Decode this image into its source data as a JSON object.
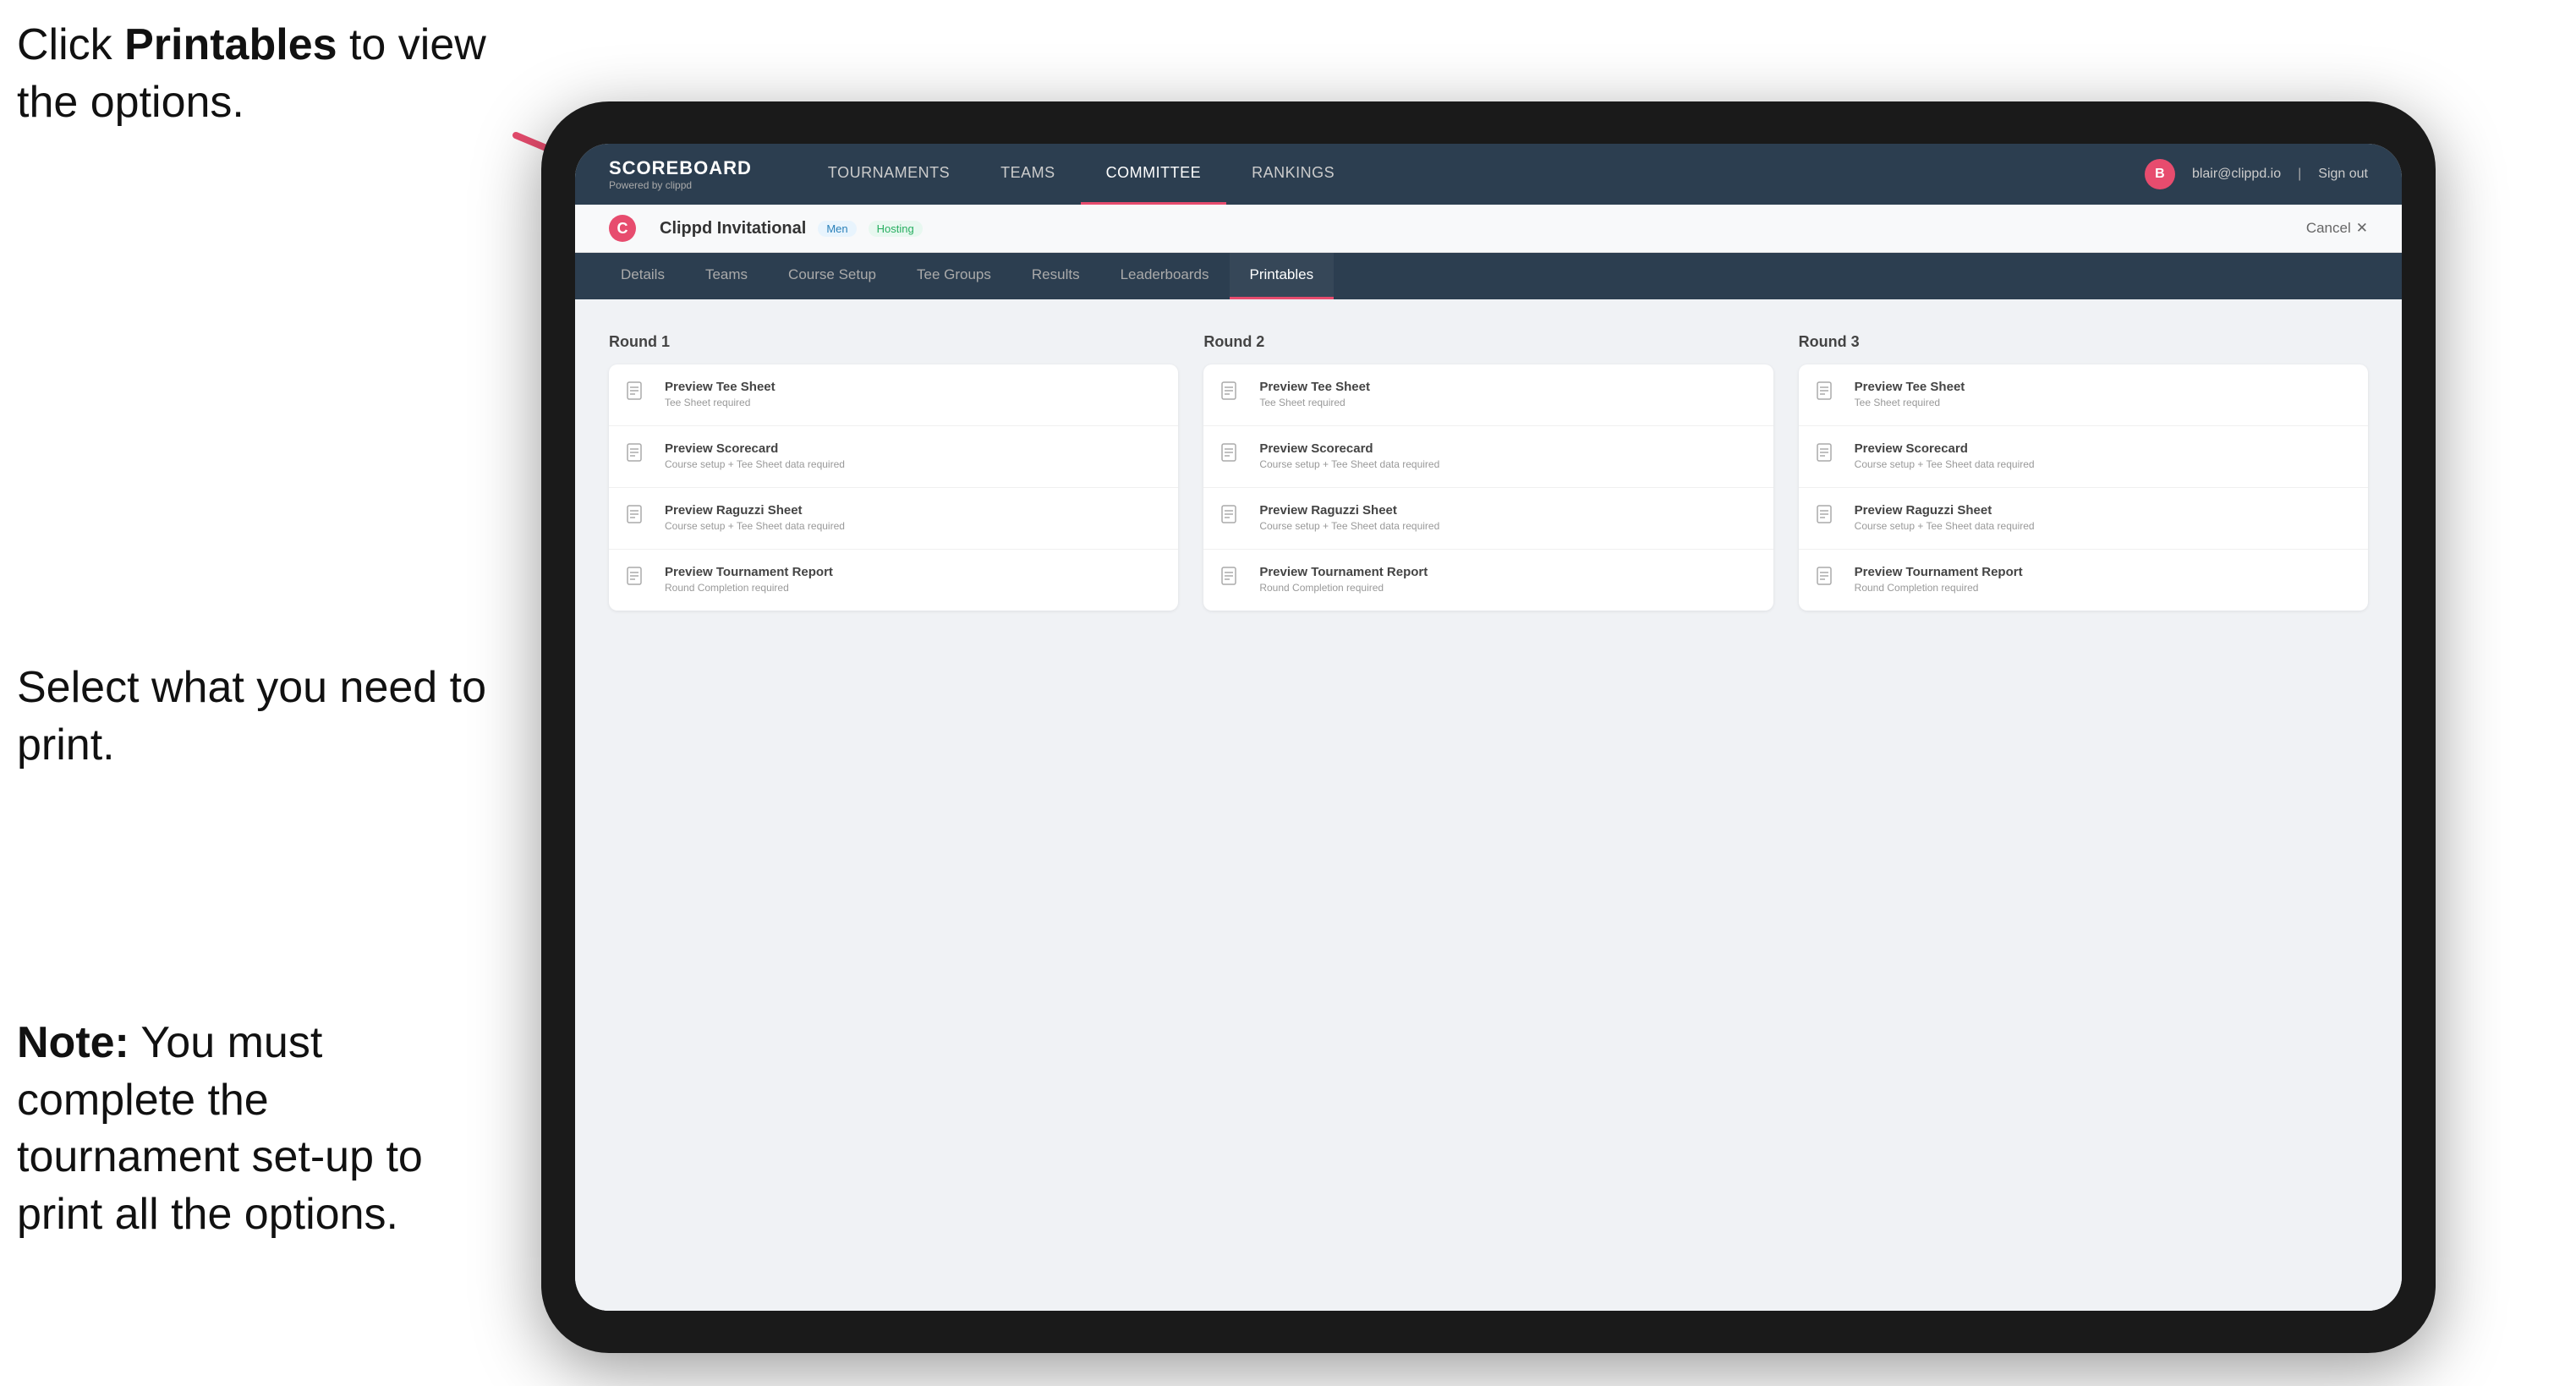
{
  "instructions": {
    "top": "Click ",
    "top_bold": "Printables",
    "top_suffix": " to view the options.",
    "middle": "Select what you need to print.",
    "bottom_bold": "Note:",
    "bottom_suffix": " You must complete the tournament set-up to print all the options."
  },
  "nav": {
    "logo_title": "SCOREBOARD",
    "logo_sub": "Powered by clippd",
    "links": [
      "TOURNAMENTS",
      "TEAMS",
      "COMMITTEE",
      "RANKINGS"
    ],
    "user_email": "blair@clippd.io",
    "sign_out": "Sign out",
    "user_initial": "B"
  },
  "tournament": {
    "name": "Clippd Invitational",
    "badge": "Men",
    "status": "Hosting",
    "cancel": "Cancel",
    "logo_letter": "C"
  },
  "tabs": [
    {
      "label": "Details"
    },
    {
      "label": "Teams"
    },
    {
      "label": "Course Setup"
    },
    {
      "label": "Tee Groups"
    },
    {
      "label": "Results"
    },
    {
      "label": "Leaderboards"
    },
    {
      "label": "Printables",
      "active": true
    }
  ],
  "rounds": [
    {
      "title": "Round 1",
      "cards": [
        {
          "title": "Preview Tee Sheet",
          "subtitle": "Tee Sheet required"
        },
        {
          "title": "Preview Scorecard",
          "subtitle": "Course setup + Tee Sheet data required"
        },
        {
          "title": "Preview Raguzzi Sheet",
          "subtitle": "Course setup + Tee Sheet data required"
        },
        {
          "title": "Preview Tournament Report",
          "subtitle": "Round Completion required"
        }
      ]
    },
    {
      "title": "Round 2",
      "cards": [
        {
          "title": "Preview Tee Sheet",
          "subtitle": "Tee Sheet required"
        },
        {
          "title": "Preview Scorecard",
          "subtitle": "Course setup + Tee Sheet data required"
        },
        {
          "title": "Preview Raguzzi Sheet",
          "subtitle": "Course setup + Tee Sheet data required"
        },
        {
          "title": "Preview Tournament Report",
          "subtitle": "Round Completion required"
        }
      ]
    },
    {
      "title": "Round 3",
      "cards": [
        {
          "title": "Preview Tee Sheet",
          "subtitle": "Tee Sheet required"
        },
        {
          "title": "Preview Scorecard",
          "subtitle": "Course setup + Tee Sheet data required"
        },
        {
          "title": "Preview Raguzzi Sheet",
          "subtitle": "Course setup + Tee Sheet data required"
        },
        {
          "title": "Preview Tournament Report",
          "subtitle": "Round Completion required"
        }
      ]
    }
  ],
  "colors": {
    "accent": "#e74c6e",
    "nav_bg": "#2c3e50"
  }
}
